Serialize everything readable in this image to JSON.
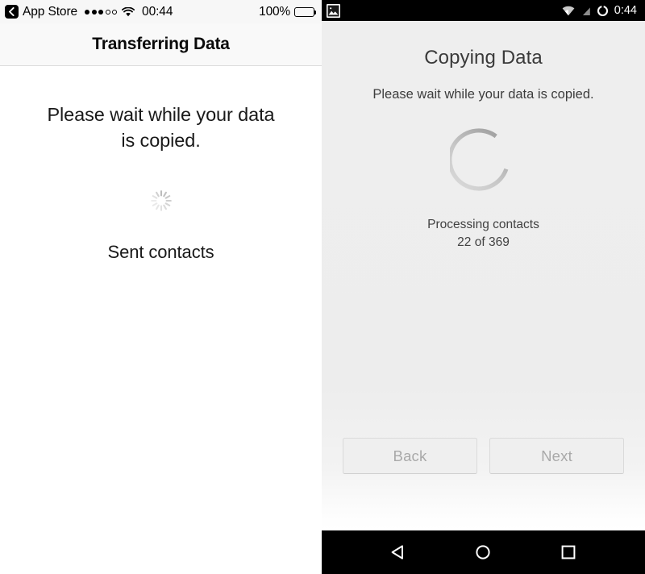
{
  "ios": {
    "status_bar": {
      "back_icon": "chevron-left-icon",
      "carrier_label": "App Store",
      "signal_dots_filled": 3,
      "signal_dots_total": 5,
      "wifi_icon": "wifi-icon",
      "time": "00:44",
      "battery_percent": "100%",
      "battery_icon": "battery-full-icon"
    },
    "nav": {
      "title": "Transferring Data"
    },
    "content": {
      "message": "Please wait while your data is copied.",
      "spinner_icon": "activity-spinner-icon",
      "status_text": "Sent contacts"
    }
  },
  "android": {
    "status_bar": {
      "gallery_icon": "gallery-image-icon",
      "wifi_icon": "wifi-icon",
      "signal_off_icon": "signal-no-service-icon",
      "battery_icon": "battery-ring-icon",
      "time": "0:44"
    },
    "content": {
      "title": "Copying Data",
      "subtitle": "Please wait while your data is copied.",
      "spinner_icon": "circular-progress-icon",
      "progress_label": "Processing contacts",
      "progress_count": "22 of 369",
      "progress_current": 22,
      "progress_total": 369
    },
    "buttons": {
      "back_label": "Back",
      "next_label": "Next"
    },
    "nav_bar": {
      "back_icon": "nav-back-triangle-icon",
      "home_icon": "nav-home-circle-icon",
      "recents_icon": "nav-recents-square-icon"
    }
  },
  "colors": {
    "ios_bg": "#ffffff",
    "ios_statusbar_bg": "#f7f7f7",
    "android_bg": "#eeeeee",
    "android_bar_bg": "#000000",
    "android_button_bg": "#efefef",
    "android_button_text": "#a9a9a9"
  }
}
